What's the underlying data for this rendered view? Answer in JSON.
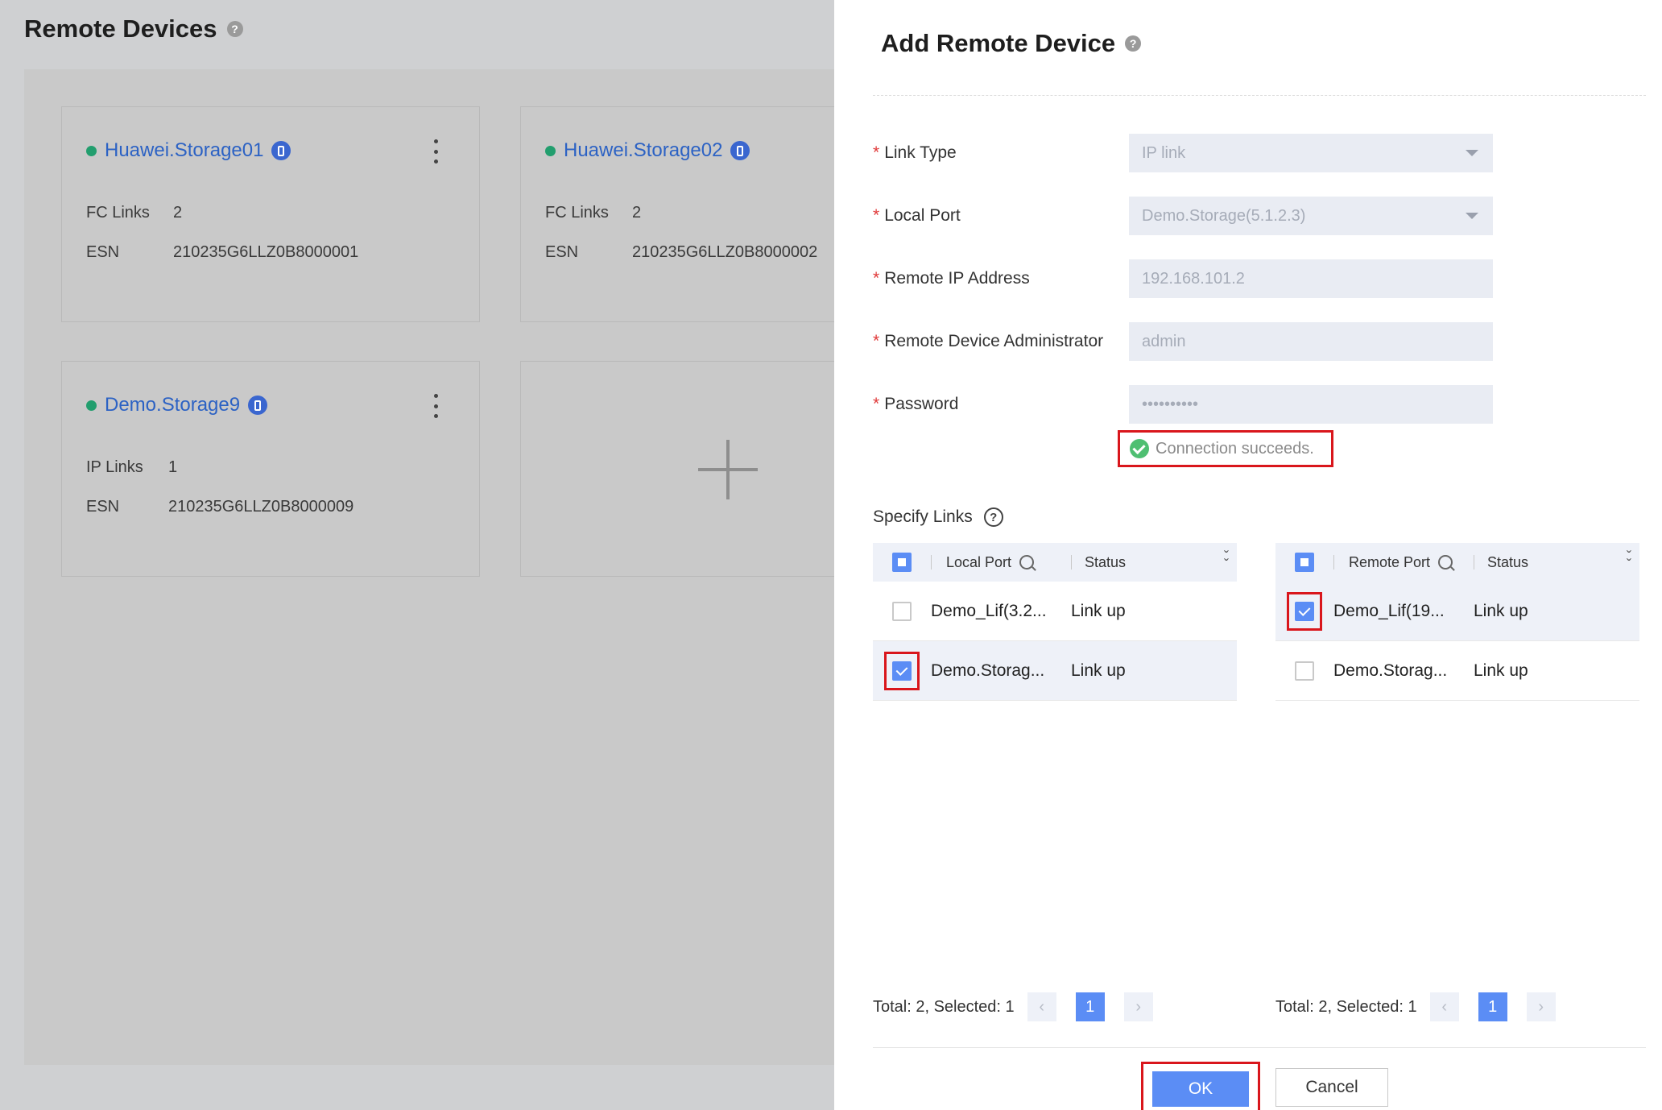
{
  "background": {
    "title": "Remote Devices",
    "cards": [
      {
        "name": "Huawei.Storage01",
        "link_label": "FC Links",
        "link_count": "2",
        "esn_label": "ESN",
        "esn": "210235G6LLZ0B8000001"
      },
      {
        "name": "Huawei.Storage02",
        "link_label": "FC Links",
        "link_count": "2",
        "esn_label": "ESN",
        "esn": "210235G6LLZ0B8000002"
      },
      {
        "name": "Demo.Storage9",
        "link_label": "IP Links",
        "link_count": "1",
        "esn_label": "ESN",
        "esn": "210235G6LLZ0B8000009"
      }
    ]
  },
  "drawer": {
    "title": "Add Remote Device",
    "fields": {
      "link_type": {
        "label": "Link Type",
        "value": "IP link"
      },
      "local_port": {
        "label": "Local Port",
        "value": "Demo.Storage(5.1.2.3)"
      },
      "remote_ip": {
        "label": "Remote IP Address",
        "value": "192.168.101.2"
      },
      "admin": {
        "label": "Remote Device Administrator",
        "value": "admin"
      },
      "password": {
        "label": "Password",
        "value": "••••••••••"
      }
    },
    "connection_status": "Connection succeeds.",
    "specify_links_label": "Specify Links",
    "local_table": {
      "col_port": "Local Port",
      "col_status": "Status",
      "rows": [
        {
          "port": "Demo_Lif(3.2...",
          "status": "Link up",
          "checked": false
        },
        {
          "port": "Demo.Storag...",
          "status": "Link up",
          "checked": true
        }
      ],
      "total_text": "Total: 2, Selected: 1",
      "page": "1"
    },
    "remote_table": {
      "col_port": "Remote Port",
      "col_status": "Status",
      "rows": [
        {
          "port": "Demo_Lif(19...",
          "status": "Link up",
          "checked": true
        },
        {
          "port": "Demo.Storag...",
          "status": "Link up",
          "checked": false
        }
      ],
      "total_text": "Total: 2, Selected: 1",
      "page": "1"
    },
    "ok_label": "OK",
    "cancel_label": "Cancel"
  },
  "colors": {
    "accent": "#5b8df5",
    "link": "#2c62c4",
    "online": "#229e6e",
    "highlight": "#d9161c"
  },
  "icons": [
    "help-icon",
    "device-icon",
    "more-icon",
    "plus-icon",
    "dropdown-caret-icon",
    "success-icon",
    "question-icon",
    "search-icon",
    "expand-icon",
    "prev-page-icon",
    "next-page-icon"
  ]
}
